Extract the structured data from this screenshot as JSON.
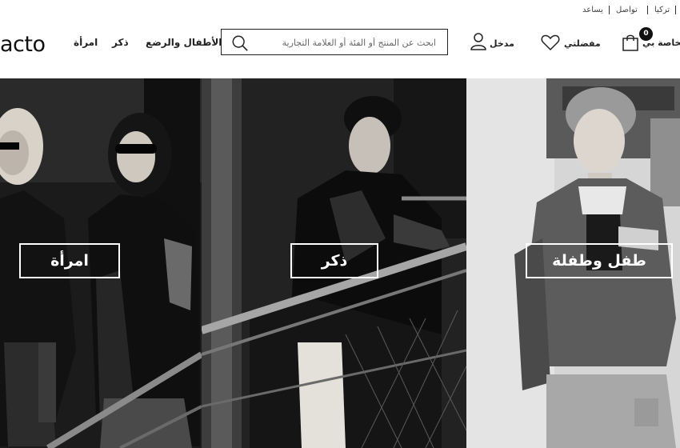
{
  "utility": {
    "country": "تركيا",
    "contact": "تواصل",
    "help": "يساعد"
  },
  "header": {
    "logo": "acto",
    "nav": {
      "women": "امرأة",
      "men": "ذكر",
      "kids": "الأطفال والرضع"
    },
    "search": {
      "placeholder": "ابحث عن المنتج أو الفئة أو العلامة التجارية"
    },
    "account_label": "مدخل",
    "favorites_label": "مفضلتي",
    "cart_label": "لخاصة بي",
    "cart_count": "0",
    "icons": {
      "search": "search-icon",
      "account": "user-icon",
      "favorites": "heart-icon",
      "cart": "shopping-bag-icon"
    }
  },
  "hero": {
    "women_label": "امرأة",
    "men_label": "ذكر",
    "kids_label": "طفل وطفلة"
  }
}
